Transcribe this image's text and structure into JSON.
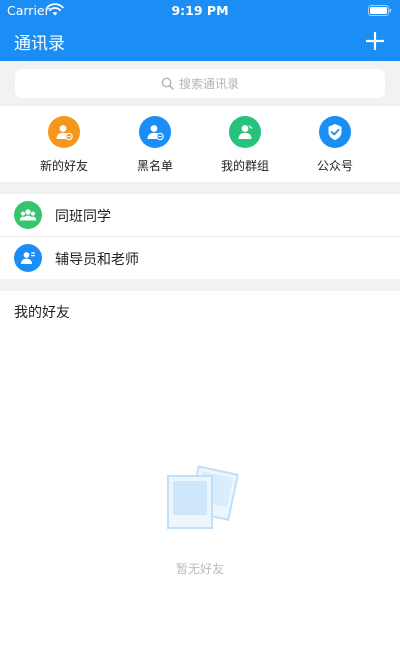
{
  "status_bar": {
    "carrier": "Carrier",
    "time": "9:19 PM"
  },
  "nav": {
    "title": "通讯录",
    "add_icon": "plus-icon"
  },
  "search": {
    "placeholder": "搜索通讯录",
    "icon": "search-icon"
  },
  "quick_actions": [
    {
      "label": "新的好友",
      "icon": "new-friend-icon",
      "color": "#f5971d"
    },
    {
      "label": "黑名单",
      "icon": "blacklist-icon",
      "color": "#1a8ef4"
    },
    {
      "label": "我的群组",
      "icon": "group-icon",
      "color": "#27c27c"
    },
    {
      "label": "公众号",
      "icon": "official-account-icon",
      "color": "#1a8ef4"
    }
  ],
  "lists": [
    {
      "label": "同班同学",
      "icon": "classmates-icon",
      "color": "#37c46d"
    },
    {
      "label": "辅导员和老师",
      "icon": "teachers-icon",
      "color": "#1a8ef4"
    }
  ],
  "friends_section": {
    "title": "我的好友"
  },
  "empty_state": {
    "text": "暂无好友",
    "icon": "empty-photos-icon"
  },
  "colors": {
    "primary": "#1a8ef4",
    "background_gray": "#f2f2f4"
  }
}
